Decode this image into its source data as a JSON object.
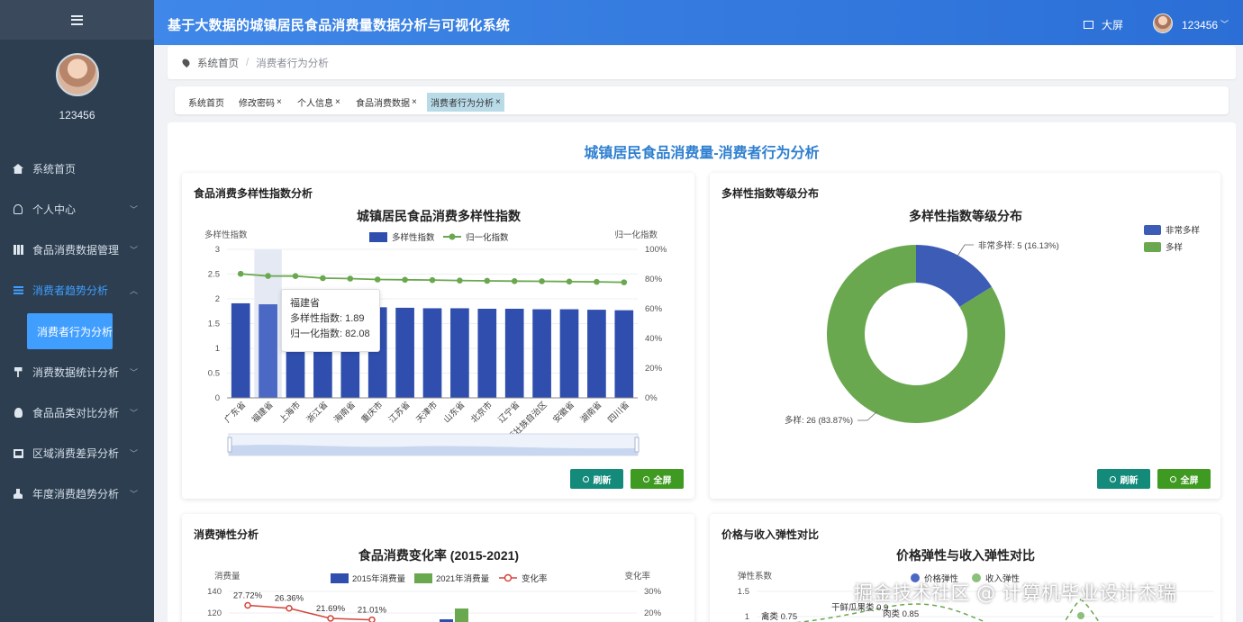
{
  "app": {
    "title": "基于大数据的城镇居民食品消费量数据分析与可视化系统",
    "bigscreen_label": "大屏",
    "username": "123456"
  },
  "sidebar": {
    "username": "123456",
    "items": [
      {
        "label": "系统首页",
        "icon": "home-icon",
        "expandable": false
      },
      {
        "label": "个人中心",
        "icon": "user-icon",
        "expandable": true
      },
      {
        "label": "食品消费数据管理",
        "icon": "grid-icon",
        "expandable": true
      },
      {
        "label": "消费者趋势分析",
        "icon": "list-icon",
        "expandable": true,
        "active": true
      },
      {
        "label": "消费数据统计分析",
        "icon": "pin-icon",
        "expandable": true
      },
      {
        "label": "食品品类对比分析",
        "icon": "bulb-icon",
        "expandable": true
      },
      {
        "label": "区域消费差异分析",
        "icon": "monitor-icon",
        "expandable": true
      },
      {
        "label": "年度消费趋势分析",
        "icon": "person-icon",
        "expandable": true
      }
    ],
    "sub_item": "消费者行为分析"
  },
  "breadcrumb": {
    "home": "系统首页",
    "separator": "/",
    "current": "消费者行为分析"
  },
  "tabs": [
    {
      "label": "系统首页",
      "closable": false
    },
    {
      "label": "修改密码",
      "closable": true
    },
    {
      "label": "个人信息",
      "closable": true
    },
    {
      "label": "食品消费数据",
      "closable": true
    },
    {
      "label": "消费者行为分析",
      "closable": true,
      "active": true
    }
  ],
  "close_glyph": "×",
  "page_title": "城镇居民食品消费量-消费者行为分析",
  "buttons": {
    "refresh": "刷新",
    "fullscreen": "全屏"
  },
  "colors": {
    "primary": "#409eff",
    "bar_blue": "#2f4eae",
    "line_green": "#6aa84f",
    "header": "#3f87e8"
  },
  "cards": {
    "diversity_index": "食品消费多样性指数分析",
    "diversity_level": "多样性指数等级分布",
    "elasticity": "消费弹性分析",
    "price_income": "价格与收入弹性对比"
  },
  "tooltip": {
    "title": "福建省",
    "line1": "多样性指数: 1.89",
    "line2": "归一化指数: 82.08"
  },
  "watermark": "掘金技术社区 @ 计算机毕业设计杰瑞",
  "chart_data": [
    {
      "type": "bar",
      "title": "城镇居民食品消费多样性指数",
      "ylabel": "多样性指数",
      "y2label": "归一化指数",
      "ylim": [
        0,
        3
      ],
      "y2lim": [
        0,
        100
      ],
      "yticks": [
        "0",
        "0.5",
        "1",
        "1.5",
        "2",
        "2.5",
        "3"
      ],
      "y2ticks": [
        "0%",
        "20%",
        "40%",
        "60%",
        "80%",
        "100%"
      ],
      "categories": [
        "广东省",
        "福建省",
        "上海市",
        "浙江省",
        "海南省",
        "重庆市",
        "江苏省",
        "天津市",
        "山东省",
        "北京市",
        "辽宁省",
        "广西壮族自治区",
        "安徽省",
        "湖南省",
        "四川省"
      ],
      "x_tick_labels": [
        "广东省",
        "福建省",
        "上海市",
        "浙江省",
        "海南省",
        "重庆市",
        "江苏省",
        "天津市",
        "山东省",
        "北京市",
        "辽宁省",
        "广西壮族自治区",
        "安徽省",
        "湖南省",
        "四川省"
      ],
      "series": [
        {
          "name": "多样性指数",
          "type": "bar",
          "axis": "left",
          "values": [
            1.91,
            1.89,
            1.86,
            1.84,
            1.83,
            1.83,
            1.82,
            1.81,
            1.81,
            1.8,
            1.8,
            1.79,
            1.79,
            1.78,
            1.77
          ]
        },
        {
          "name": "归一化指数",
          "type": "line",
          "axis": "right",
          "values": [
            83.5,
            82.08,
            82.0,
            80.6,
            80.3,
            79.7,
            79.5,
            79.3,
            79.0,
            78.8,
            78.6,
            78.5,
            78.3,
            78.1,
            77.8
          ]
        }
      ],
      "legend": "top",
      "highlighted_category": "福建省"
    },
    {
      "type": "pie",
      "title": "多样性指数等级分布",
      "slices": [
        {
          "name": "非常多样",
          "value": 5,
          "percent": "16.13%",
          "label": "非常多样: 5 (16.13%)"
        },
        {
          "name": "多样",
          "value": 26,
          "percent": "83.87%",
          "label": "多样: 26 (83.87%)"
        }
      ],
      "legend": "top-right"
    },
    {
      "type": "bar",
      "title": "食品消费变化率 (2015-2021)",
      "ylabel": "消费量",
      "y2label": "变化率",
      "yticks_visible": [
        "140",
        "120"
      ],
      "y2ticks_visible": [
        "30%",
        "20%"
      ],
      "legend": "top",
      "series": [
        {
          "name": "2015年消费量",
          "type": "bar"
        },
        {
          "name": "2021年消费量",
          "type": "bar"
        },
        {
          "name": "变化率",
          "type": "line",
          "values": [
            27.72,
            26.36,
            21.69,
            21.01
          ],
          "labels": [
            "27.72%",
            "26.36%",
            "21.69%",
            "21.01%"
          ]
        }
      ]
    },
    {
      "type": "line",
      "title": "价格弹性与收入弹性对比",
      "ylabel": "弹性系数",
      "yticks_visible": [
        "1.5",
        "1"
      ],
      "legend": "top",
      "series": [
        {
          "name": "价格弹性"
        },
        {
          "name": "收入弹性"
        }
      ],
      "point_labels": [
        "禽类 0.75",
        "干鲜瓜果类 0.9",
        "肉类 0.85"
      ]
    }
  ]
}
